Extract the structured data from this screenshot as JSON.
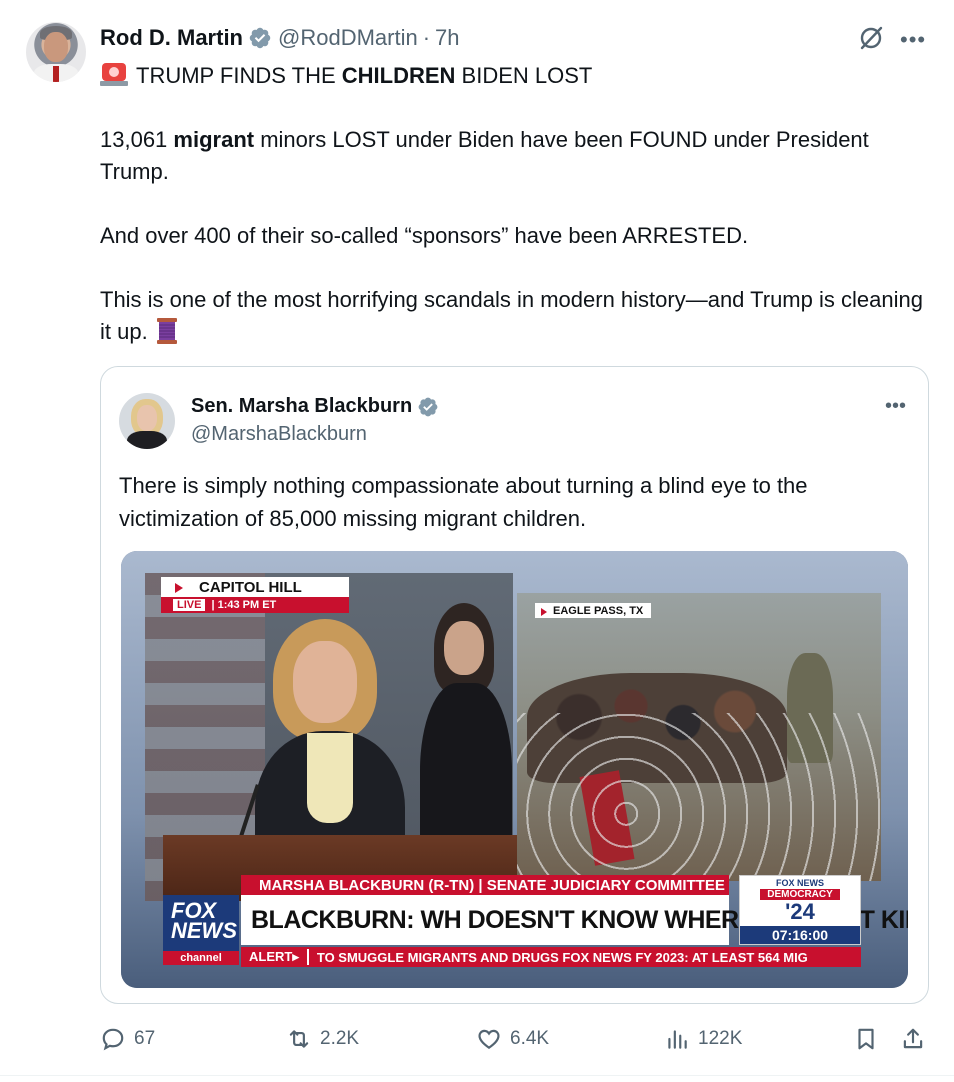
{
  "post": {
    "author_name": "Rod D. Martin",
    "handle": "@RodDMartin",
    "separator": "·",
    "time": "7h",
    "headline_pre": "TRUMP FINDS THE ",
    "headline_bold": "CHILDREN",
    "headline_post": " BIDEN LOST",
    "p1_pre": "13,061 ",
    "p1_bold": "migrant",
    "p1_post": " minors LOST under Biden have been FOUND under President Trump.",
    "p2": "And over 400 of their so-called “sponsors” have been ARRESTED.",
    "p3": "This is one of the most horrifying scandals in modern history—and Trump is cleaning it up."
  },
  "quote": {
    "author_name": "Sen. Marsha Blackburn",
    "handle": "@MarshaBlackburn",
    "text": "There is simply nothing compassionate about turning a blind eye to the victimization of 85,000 missing migrant children.",
    "video": {
      "location_left": "CAPITOL HILL",
      "live_tag": "LIVE",
      "live_time": "| 1:43 PM ET",
      "location_right": "EAGLE PASS, TX",
      "lower_third_top": "MARSHA BLACKBURN (R-TN) | SENATE JUDICIARY COMMITTEE",
      "lower_third_main": "BLACKBURN: WH DOESN'T KNOW WHERE MIGRANT KIDS ARE",
      "logo_line1": "FOX",
      "logo_line2": "NEWS",
      "logo_channel": "channel",
      "ticker_alert": "ALERT▸",
      "ticker_text": "TO SMUGGLE MIGRANTS AND DRUGS   FOX NEWS FY 2023: AT LEAST 564 MIG",
      "democracy_t1": "FOX NEWS",
      "democracy_t2": "DEMOCRACY",
      "democracy_t3": "'24",
      "democracy_clock": "07:16:00"
    }
  },
  "actions": {
    "replies": "67",
    "reposts": "2.2K",
    "likes": "6.4K",
    "views": "122K"
  },
  "colors": {
    "text": "#0f1419",
    "secondary": "#536471",
    "verified": "#829aab",
    "border": "#cfd9de",
    "fox_red": "#c8102e",
    "fox_blue": "#1c3a7a"
  }
}
